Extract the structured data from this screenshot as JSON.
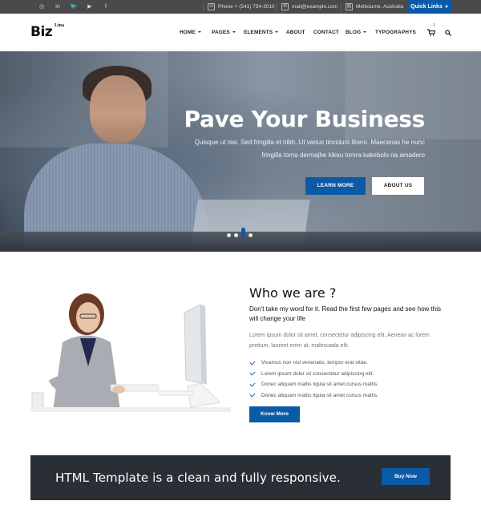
{
  "topbar": {
    "social": [
      {
        "icon": "instagram-icon",
        "glyph": "◎"
      },
      {
        "icon": "linkedin-icon",
        "glyph": "in"
      },
      {
        "icon": "twitter-icon",
        "glyph": "🐦"
      },
      {
        "icon": "youtube-icon",
        "glyph": "▶"
      },
      {
        "icon": "facebook-icon",
        "glyph": "f"
      }
    ],
    "phone": "Phone + (541) 754-3010",
    "email": "mail@example.com",
    "location": "Melbourne, Australia",
    "quick_links": "Quick Links"
  },
  "header": {
    "logo": "Biz",
    "logo_sup": "Lina",
    "nav": [
      "HOME",
      "PAGES",
      "ELEMENTS",
      "ABOUT",
      "CONTACT",
      "BLOG",
      "TYPOGRAPHYS"
    ],
    "cart_count": "1"
  },
  "hero": {
    "title": "Pave Your Business",
    "text_line1": "Quisque ut nisi. Sed fringilla et nibh. Ut varius tincidunt libero. Maecenas he nunc",
    "text_line2": "fringilla toma dermajhe kikeu tomra kakebolo na amadero",
    "btn_learn": "LEARN MORE",
    "btn_about": "ABOUT US"
  },
  "who": {
    "title": "Who we are ?",
    "subtitle": "Don't take my word for it. Read the first few pages and see how this will change your life",
    "paragraph": "Lorem ipsum dolor sit amet, consectetur adipiscing elit. Aenean ac lorem pretium, laoreet enim at, malesuada elit.",
    "checks": [
      "Vivamus non nisl venenatis, tempor erat vitae.",
      "Lorem ipsum dolor sit consectetur adipiscing elit.",
      "Donec aliquam mattis ligula sit amet cursus mattis.",
      "Donec aliquam mattis ligula sit amet cursus mattis."
    ],
    "button": "Know More"
  },
  "cta": {
    "text": "HTML Template is a clean and fully responsive.",
    "button": "Buy Now"
  },
  "colors": {
    "accent": "#0b5aa6",
    "topbar": "#4a4a4a",
    "cta_bg": "#2a2f36"
  }
}
